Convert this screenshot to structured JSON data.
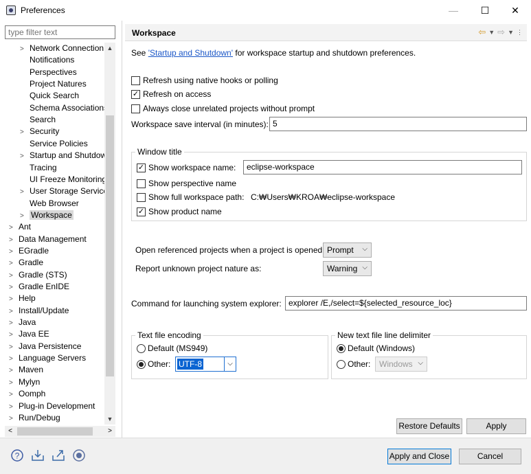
{
  "window": {
    "title": "Preferences",
    "min": "—",
    "max": "☐",
    "close": "✕"
  },
  "filter": {
    "placeholder": "type filter text"
  },
  "tree": [
    {
      "label": "Network Connection",
      "indent": 1,
      "arrow": ">"
    },
    {
      "label": "Notifications",
      "indent": 1,
      "arrow": ""
    },
    {
      "label": "Perspectives",
      "indent": 1,
      "arrow": ""
    },
    {
      "label": "Project Natures",
      "indent": 1,
      "arrow": ""
    },
    {
      "label": "Quick Search",
      "indent": 1,
      "arrow": ""
    },
    {
      "label": "Schema Associations",
      "indent": 1,
      "arrow": ""
    },
    {
      "label": "Search",
      "indent": 1,
      "arrow": ""
    },
    {
      "label": "Security",
      "indent": 1,
      "arrow": ">"
    },
    {
      "label": "Service Policies",
      "indent": 1,
      "arrow": ""
    },
    {
      "label": "Startup and Shutdow",
      "indent": 1,
      "arrow": ">"
    },
    {
      "label": "Tracing",
      "indent": 1,
      "arrow": ""
    },
    {
      "label": "UI Freeze Monitoring",
      "indent": 1,
      "arrow": ""
    },
    {
      "label": "User Storage Service",
      "indent": 1,
      "arrow": ">"
    },
    {
      "label": "Web Browser",
      "indent": 1,
      "arrow": ""
    },
    {
      "label": "Workspace",
      "indent": 1,
      "arrow": ">",
      "selected": true
    },
    {
      "label": "Ant",
      "indent": 0,
      "arrow": ">"
    },
    {
      "label": "Data Management",
      "indent": 0,
      "arrow": ">"
    },
    {
      "label": "EGradle",
      "indent": 0,
      "arrow": ">"
    },
    {
      "label": "Gradle",
      "indent": 0,
      "arrow": ">"
    },
    {
      "label": "Gradle (STS)",
      "indent": 0,
      "arrow": ">"
    },
    {
      "label": "Gradle EnIDE",
      "indent": 0,
      "arrow": ">"
    },
    {
      "label": "Help",
      "indent": 0,
      "arrow": ">"
    },
    {
      "label": "Install/Update",
      "indent": 0,
      "arrow": ">"
    },
    {
      "label": "Java",
      "indent": 0,
      "arrow": ">"
    },
    {
      "label": "Java EE",
      "indent": 0,
      "arrow": ">"
    },
    {
      "label": "Java Persistence",
      "indent": 0,
      "arrow": ">"
    },
    {
      "label": "Language Servers",
      "indent": 0,
      "arrow": ">"
    },
    {
      "label": "Maven",
      "indent": 0,
      "arrow": ">"
    },
    {
      "label": "Mylyn",
      "indent": 0,
      "arrow": ">"
    },
    {
      "label": "Oomph",
      "indent": 0,
      "arrow": ">"
    },
    {
      "label": "Plug-in Development",
      "indent": 0,
      "arrow": ">"
    },
    {
      "label": "Run/Debug",
      "indent": 0,
      "arrow": ">"
    }
  ],
  "page": {
    "title": "Workspace",
    "see_prefix": "See ",
    "see_link": "'Startup and Shutdown'",
    "see_suffix": " for workspace startup and shutdown preferences.",
    "refresh_native": "Refresh using native hooks or polling",
    "refresh_access": "Refresh on access",
    "always_close": "Always close unrelated projects without prompt",
    "save_interval_label": "Workspace save interval (in minutes):",
    "save_interval_value": "5",
    "window_title_group": "Window title",
    "show_ws_name": "Show workspace name:",
    "ws_name_value": "eclipse-workspace",
    "show_persp": "Show perspective name",
    "show_full_path": "Show full workspace path:",
    "full_path_value": "C:₩Users₩KROA₩eclipse-workspace",
    "show_product": "Show product name",
    "open_ref_label": "Open referenced projects when a project is opened:",
    "open_ref_value": "Prompt",
    "report_label": "Report unknown project nature as:",
    "report_value": "Warning",
    "cmd_label": "Command for launching system explorer:",
    "cmd_value": "explorer /E,/select=${selected_resource_loc}",
    "enc_group": "Text file encoding",
    "enc_default": "Default (MS949)",
    "enc_other": "Other:",
    "enc_value": "UTF-8",
    "delim_group": "New text file line delimiter",
    "delim_default": "Default (Windows)",
    "delim_other": "Other:",
    "delim_value": "Windows"
  },
  "buttons": {
    "restore": "Restore Defaults",
    "apply": "Apply",
    "apply_close": "Apply and Close",
    "cancel": "Cancel"
  },
  "checked": {
    "refresh_native": false,
    "refresh_access": true,
    "always_close": false,
    "show_ws_name": true,
    "show_persp": false,
    "show_full_path": false,
    "show_product": true
  }
}
